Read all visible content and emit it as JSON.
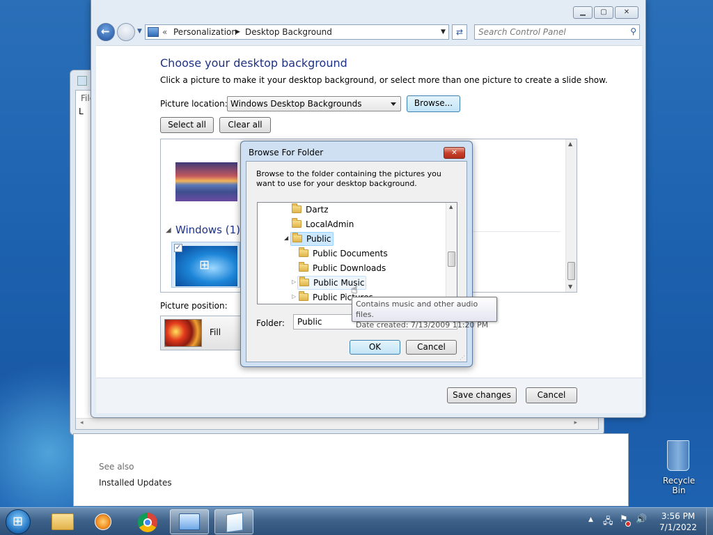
{
  "main_window": {
    "breadcrumb": [
      "Personalization",
      "Desktop Background"
    ],
    "breadcrumb_prefix": "«",
    "search_placeholder": "Search Control Panel",
    "heading": "Choose your desktop background",
    "instructions": "Click a picture to make it your desktop background, or select more than one picture to create a slide show.",
    "picture_location_label": "Picture location:",
    "picture_location_value": "Windows Desktop Backgrounds",
    "browse_label": "Browse...",
    "select_all_label": "Select all",
    "clear_all_label": "Clear all",
    "group_title": "Windows (1)",
    "picture_position_label": "Picture position:",
    "picture_position_value": "Fill",
    "save_label": "Save changes",
    "cancel_label": "Cancel"
  },
  "back_window": {
    "menu_fragment": "File",
    "text_fragment": "L"
  },
  "see_also": {
    "title": "See also",
    "link": "Installed Updates"
  },
  "dialog": {
    "title": "Browse For Folder",
    "description": "Browse to the folder containing the pictures you want to use for your desktop background.",
    "tree": [
      {
        "label": "Dartz",
        "level": 0,
        "expander": ""
      },
      {
        "label": "LocalAdmin",
        "level": 0,
        "expander": ""
      },
      {
        "label": "Public",
        "level": 0,
        "expander": "expanded",
        "selected": true
      },
      {
        "label": "Public Documents",
        "level": 1,
        "expander": ""
      },
      {
        "label": "Public Downloads",
        "level": 1,
        "expander": ""
      },
      {
        "label": "Public Music",
        "level": 1,
        "expander": "collapsed",
        "hover": true
      },
      {
        "label": "Public Pictures",
        "level": 1,
        "expander": "collapsed"
      }
    ],
    "folder_label": "Folder:",
    "folder_value": "Public",
    "ok_label": "OK",
    "cancel_label": "Cancel"
  },
  "tooltip": {
    "line1": "Contains music and other audio files.",
    "line2": "Date created: 7/13/2009 11:20 PM"
  },
  "desktop": {
    "recycle_bin": "Recycle Bin"
  },
  "taskbar": {
    "time": "3:56 PM",
    "date": "7/1/2022",
    "apps": [
      "start-orb",
      "file-explorer",
      "media-player",
      "chrome",
      "control-panel",
      "notepad"
    ]
  },
  "colors": {
    "heading_blue": "#1e3287",
    "tooltip_text": "#4c4c4c",
    "selected_bg": "#cce8ff"
  }
}
